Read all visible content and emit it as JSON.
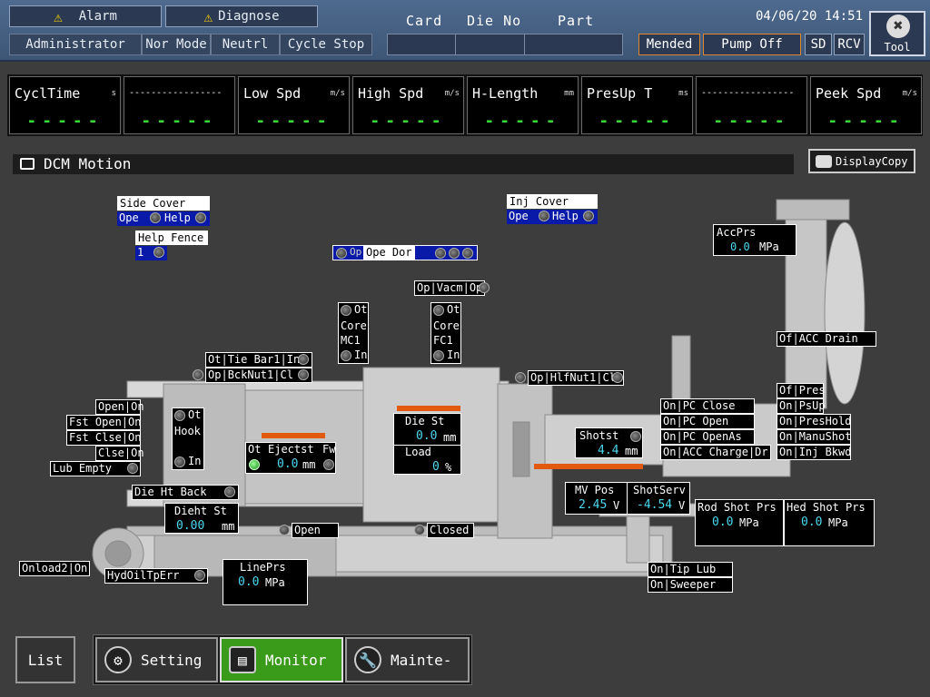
{
  "header": {
    "alarm": "Alarm",
    "diagnose": "Diagnose",
    "user": "Administrator",
    "mode": "Nor Mode",
    "neutral": "Neutrl",
    "cycle": "Cycle Stop",
    "card_label": "Card",
    "die_label": "Die No",
    "part_label": "Part",
    "datetime": "04/06/20 14:51",
    "mended": "Mended",
    "pump": "Pump Off",
    "sd": "SD",
    "rcv": "RCV",
    "tool": "Tool"
  },
  "monitor": [
    {
      "label": "CyclTime",
      "unit": "s",
      "value": "-----"
    },
    {
      "label": "-----------------",
      "unit": "",
      "value": "-----"
    },
    {
      "label": "Low Spd",
      "unit": "m/s",
      "value": "-----"
    },
    {
      "label": "High Spd",
      "unit": "m/s",
      "value": "-----"
    },
    {
      "label": "H-Length",
      "unit": "mm",
      "value": "-----"
    },
    {
      "label": "PresUp T",
      "unit": "ms",
      "value": "-----"
    },
    {
      "label": "-----------------",
      "unit": "",
      "value": "-----"
    },
    {
      "label": "Peek Spd",
      "unit": "m/s",
      "value": "-----"
    }
  ],
  "panel": {
    "title": "DCM Motion",
    "display_copy": "DisplayCopy"
  },
  "labels": {
    "side_cover": "Side Cover",
    "ope": "Ope",
    "help": "Help",
    "help_fence": "Help Fence",
    "one": "1",
    "inj_cover": "Inj Cover",
    "op": "Op",
    "ope_dor": "Ope Dor",
    "vacm": "Vacm",
    "acc_prs": "AccPrs",
    "acc_prs_val": "0.0",
    "mpa": "MPa",
    "of": "Of",
    "acc_drain": "ACC Drain",
    "ot": "Ot",
    "in": "In",
    "core": "Core",
    "mc1": "MC1",
    "fc1": "FC1",
    "tie_bar": "Tie Bar1",
    "bck_nut": "BckNut1",
    "cl": "Cl",
    "hlf_nut": "HlfNut1",
    "on": "On",
    "open": "Open",
    "fst_open": "Fst Open",
    "fst_clse": "Fst Clse",
    "clse": "Clse",
    "lub_empty": "Lub Empty",
    "hook": "Hook",
    "ejectst": "Ejectst",
    "fw": "Fw",
    "eject_val": "0.0",
    "mm": "mm",
    "die_st": "Die St",
    "die_st_val": "0.0",
    "load": "Load",
    "load_val": "0",
    "pct": "%",
    "shotst": "Shotst",
    "shotst_val": "4.4",
    "pc_close": "PC Close",
    "pc_open": "PC Open",
    "pc_openas": "PC OpenAs",
    "acc_charge": "ACC Charge",
    "dr": "Dr",
    "pres": "Pres",
    "psup": "PsUp",
    "preshold": "PresHold",
    "manushot": "ManuShot",
    "inj_bkwd": "Inj Bkwd",
    "die_ht_back": "Die Ht Back",
    "mv_pos": "MV Pos",
    "mv_val": "2.45",
    "v": "V",
    "shotserv": "ShotServ",
    "shotserv_val": "-4.54",
    "rod_shot": "Rod Shot Prs",
    "rod_val": "0.0",
    "hed_shot": "Hed Shot Prs",
    "hed_val": "0.0",
    "dieht_st": "Dieht St",
    "dieht_val": "0.00",
    "closed": "Closed",
    "onload2": "Onload2",
    "hydoil": "HydOilTpErr",
    "lineprs": "LinePrs",
    "lineprs_val": "0.0",
    "tip_lub": "Tip Lub",
    "sweeper": "Sweeper"
  },
  "footer": {
    "list": "List",
    "setting": "Setting",
    "monitor": "Monitor",
    "mainte": "Mainte-"
  },
  "colors": {
    "header": "#4e6a8e",
    "bg": "#3d3d3d",
    "active_green": "#3a9a1a",
    "led_blue": "#0a1aa8"
  }
}
